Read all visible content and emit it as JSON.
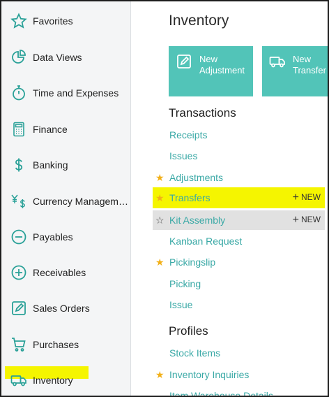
{
  "sidebar": {
    "items": [
      {
        "label": "Favorites",
        "icon": "star-icon"
      },
      {
        "label": "Data Views",
        "icon": "pie-chart-icon"
      },
      {
        "label": "Time and Expenses",
        "icon": "stopwatch-icon"
      },
      {
        "label": "Finance",
        "icon": "calculator-icon"
      },
      {
        "label": "Banking",
        "icon": "dollar-icon"
      },
      {
        "label": "Currency Managem…",
        "icon": "currency-yen-dollar-icon"
      },
      {
        "label": "Payables",
        "icon": "minus-circle-icon"
      },
      {
        "label": "Receivables",
        "icon": "plus-circle-icon"
      },
      {
        "label": "Sales Orders",
        "icon": "edit-icon"
      },
      {
        "label": "Purchases",
        "icon": "cart-icon"
      },
      {
        "label": "Inventory",
        "icon": "truck-icon"
      }
    ]
  },
  "main": {
    "title": "Inventory",
    "tiles": [
      {
        "line1": "New",
        "line2": "Adjustment",
        "icon": "edit-icon"
      },
      {
        "line1": "New",
        "line2": "Transfer",
        "icon": "truck-icon"
      }
    ],
    "transactions_heading": "Transactions",
    "transactions": [
      {
        "label": "Receipts",
        "star": "none",
        "new": ""
      },
      {
        "label": "Issues",
        "star": "none",
        "new": ""
      },
      {
        "label": "Adjustments",
        "star": "filled",
        "new": ""
      },
      {
        "label": "Transfers",
        "star": "filled",
        "new": "NEW"
      },
      {
        "label": "Kit Assembly",
        "star": "empty",
        "new": "NEW"
      },
      {
        "label": "Kanban Request",
        "star": "none",
        "new": ""
      },
      {
        "label": "Pickingslip",
        "star": "filled",
        "new": ""
      },
      {
        "label": "Picking",
        "star": "none",
        "new": ""
      },
      {
        "label": "Issue",
        "star": "none",
        "new": ""
      }
    ],
    "profiles_heading": "Profiles",
    "profiles": [
      {
        "label": "Stock Items",
        "star": "none"
      },
      {
        "label": "Inventory Inquiries",
        "star": "filled"
      },
      {
        "label": "Item Warehouse Details",
        "star": "none"
      }
    ]
  },
  "colors": {
    "accent": "#52c4b8",
    "link": "#3aa9a6",
    "star": "#f2b018",
    "highlight": "#f5f500"
  }
}
